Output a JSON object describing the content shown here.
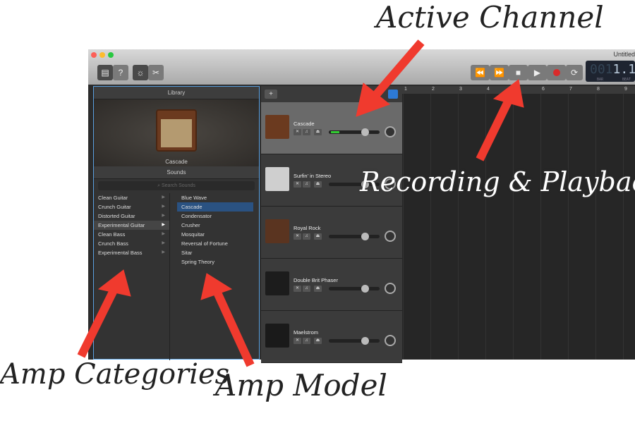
{
  "window": {
    "title": "Untitled",
    "lcd": {
      "bar_value": "001",
      "beat_value": "1.1",
      "bar_label": "BAR",
      "beat_label": "BEAT"
    }
  },
  "toolbar": {
    "library_icon": "library-icon",
    "help_icon": "help-icon",
    "smart_controls_icon": "smart-controls-icon",
    "editor_icon": "scissors-icon"
  },
  "transport": {
    "rewind": "⏪",
    "forward": "⏩",
    "stop": "■",
    "play": "▶",
    "record_color": "#d92b2b",
    "cycle": "⟳"
  },
  "library": {
    "title": "Library",
    "preview_name": "Cascade",
    "sounds_title": "Sounds",
    "search_placeholder": "Search Sounds",
    "categories": [
      "Clean Guitar",
      "Crunch Guitar",
      "Distorted Guitar",
      "Experimental Guitar",
      "Clean Bass",
      "Crunch Bass",
      "Experimental Bass"
    ],
    "selected_category": "Experimental Guitar",
    "models": [
      "Blue Wave",
      "Cascade",
      "Condensator",
      "Crusher",
      "Mosquitar",
      "Reversal of Fortune",
      "Sitar",
      "Spring Theory"
    ],
    "selected_model": "Cascade"
  },
  "tracks": {
    "add_label": "+",
    "items": [
      {
        "name": "Cascade",
        "active": true
      },
      {
        "name": "Surfin' in Stereo"
      },
      {
        "name": "Royal Rock"
      },
      {
        "name": "Double Brit Phaser"
      },
      {
        "name": "Maelstrom"
      }
    ]
  },
  "ruler": [
    "1",
    "2",
    "3",
    "4",
    "5",
    "6",
    "7",
    "8",
    "9"
  ],
  "annotations": {
    "active_channel": "Active Channel",
    "recording": "Recording & Playback",
    "amp_categories": "Amp Categories",
    "amp_model": "Amp Model",
    "arrow_color": "#f03a2e"
  }
}
